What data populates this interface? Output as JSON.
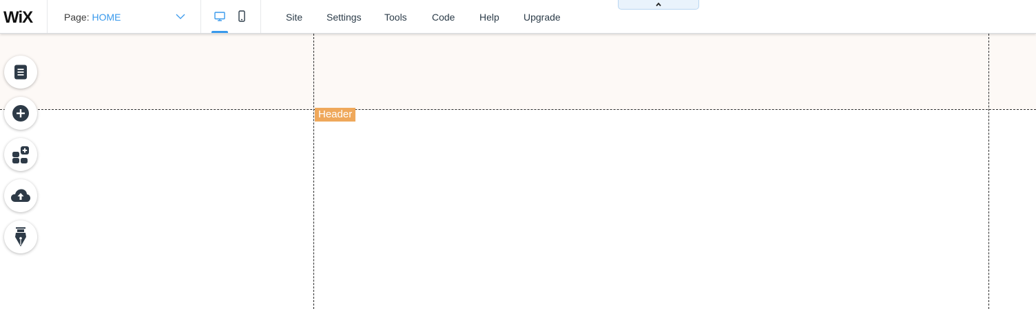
{
  "logo": {
    "text": "WiX"
  },
  "page_selector": {
    "prefix": "Page:",
    "value": "HOME",
    "icon": "chevron-down-icon"
  },
  "devices": [
    {
      "name": "desktop",
      "icon": "desktop-icon",
      "active": true
    },
    {
      "name": "mobile",
      "icon": "mobile-icon",
      "active": false
    }
  ],
  "menu": [
    "Site",
    "Settings",
    "Tools",
    "Code",
    "Help",
    "Upgrade"
  ],
  "collapse_tab": {
    "icon": "chevron-up-icon"
  },
  "canvas": {
    "section_label": "Header",
    "section_label_color": "#efa85b",
    "header_bg": "#fdf9f6"
  },
  "left_tools": [
    {
      "name": "pages",
      "icon": "pages-icon"
    },
    {
      "name": "add",
      "icon": "plus-circle-icon"
    },
    {
      "name": "add-apps",
      "icon": "apps-add-icon"
    },
    {
      "name": "upload",
      "icon": "cloud-upload-icon"
    },
    {
      "name": "design",
      "icon": "pen-nib-icon"
    }
  ],
  "colors": {
    "accent": "#3899ec",
    "text": "#2b3b48",
    "icon": "#2d3a47"
  }
}
